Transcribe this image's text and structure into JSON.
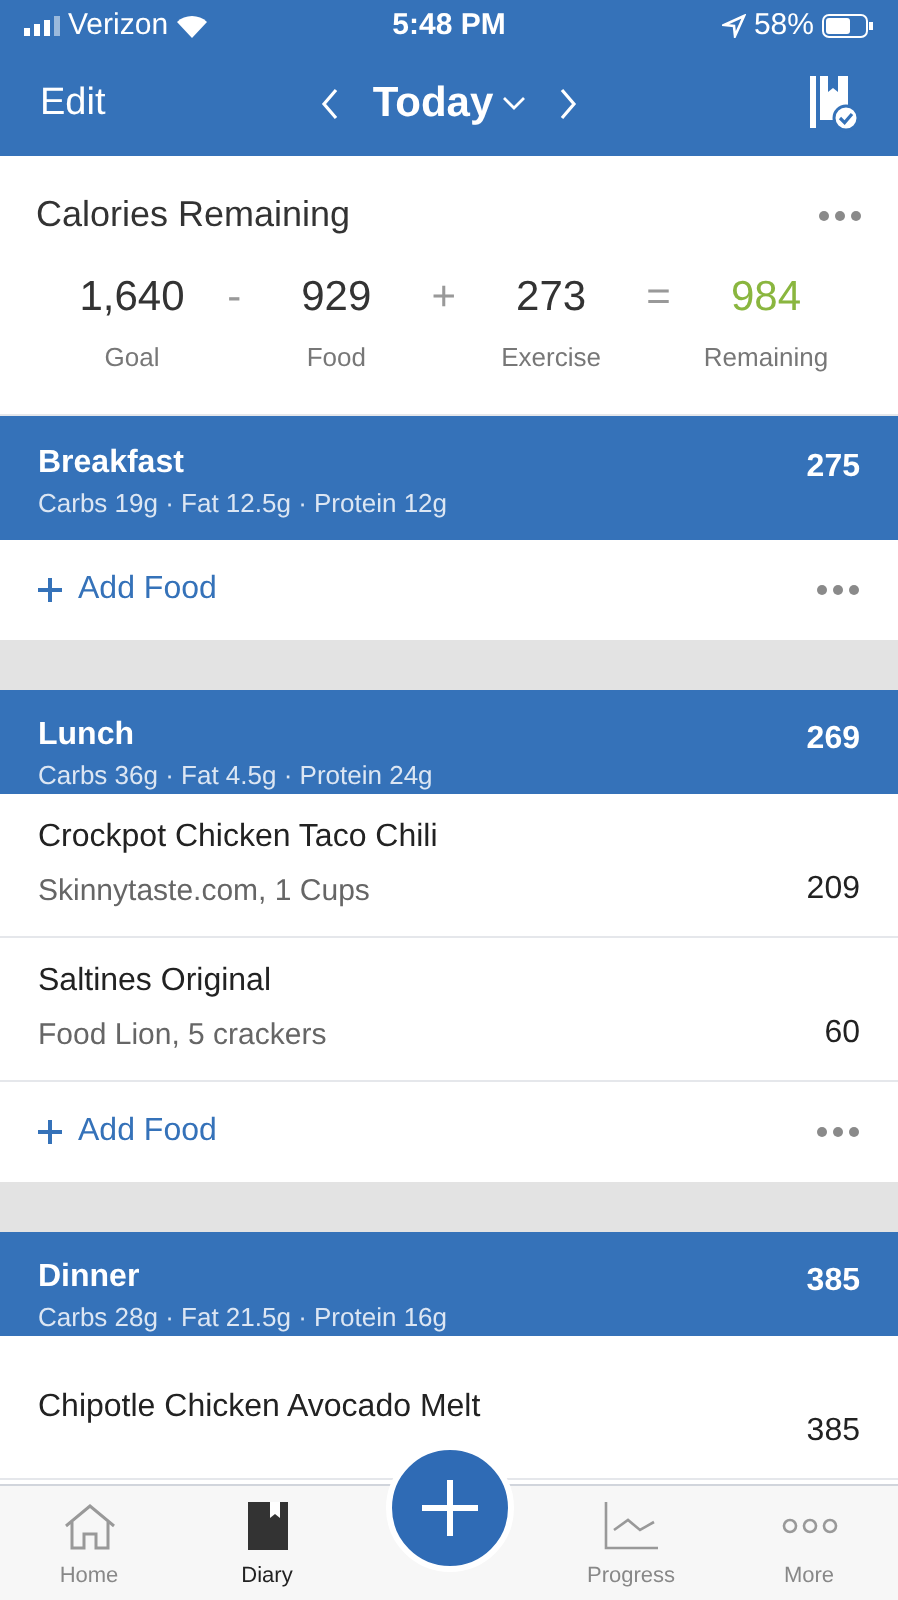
{
  "status_bar": {
    "carrier": "Verizon",
    "time": "5:48 PM",
    "battery": "58%"
  },
  "nav": {
    "edit": "Edit",
    "date": "Today"
  },
  "summary": {
    "title": "Calories Remaining",
    "items": [
      {
        "value": "1,640",
        "label": "Goal",
        "operator": "-",
        "highlight": false
      },
      {
        "value": "929",
        "label": "Food",
        "operator": "+",
        "highlight": false
      },
      {
        "value": "273",
        "label": "Exercise",
        "operator": "=",
        "highlight": false
      },
      {
        "value": "984",
        "label": "Remaining",
        "highlight": true
      }
    ]
  },
  "meals": [
    {
      "name": "Breakfast",
      "macros": "Carbs 19g · Fat 12.5g · Protein 12g",
      "calories": "275",
      "add_label": "Add Food"
    },
    {
      "name": "Lunch",
      "macros": "Carbs 36g · Fat 4.5g · Protein 24g",
      "calories": "269",
      "items": [
        {
          "name": "Crockpot Chicken Taco Chili",
          "detail": "Skinnytaste.com, 1 Cups",
          "calories": "209"
        },
        {
          "name": "Saltines Original",
          "detail": "Food Lion, 5 crackers",
          "calories": "60"
        }
      ],
      "add_label": "Add Food"
    },
    {
      "name": "Dinner",
      "macros": "Carbs 28g · Fat 21.5g · Protein 16g",
      "calories": "385",
      "items": [
        {
          "name": "Chipotle Chicken Avocado Melt",
          "calories": "385"
        }
      ]
    }
  ],
  "tab_bar": [
    {
      "label": "Home",
      "kind": "home",
      "selected": false
    },
    {
      "label": "Diary",
      "kind": "diary",
      "selected": true
    },
    {
      "kind": "add"
    },
    {
      "label": "Progress",
      "kind": "progress",
      "selected": false
    },
    {
      "label": "More",
      "kind": "more",
      "selected": false
    }
  ]
}
